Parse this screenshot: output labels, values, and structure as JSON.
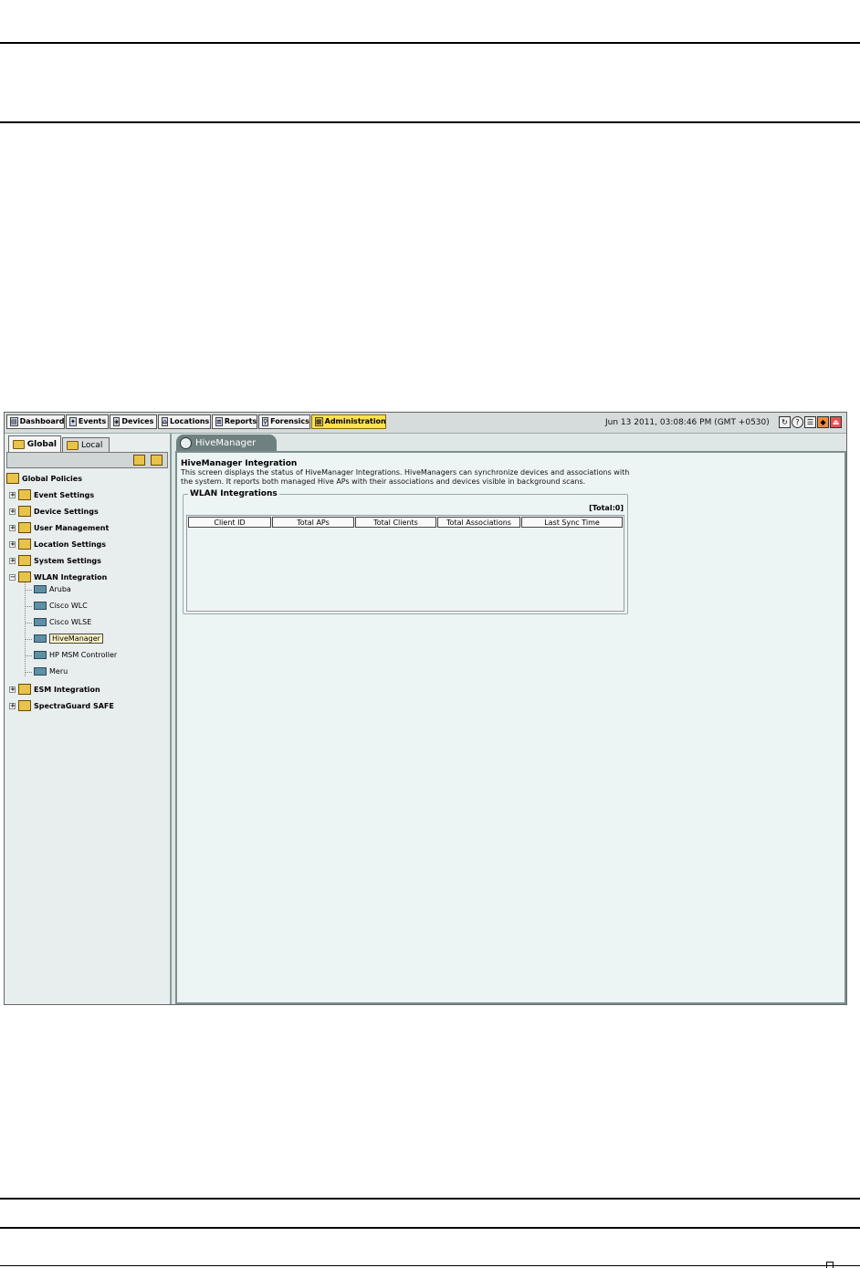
{
  "toolbar": {
    "tabs": [
      {
        "label": "Dashboard",
        "icon": "dashboard-icon"
      },
      {
        "label": "Events",
        "icon": "events-icon"
      },
      {
        "label": "Devices",
        "icon": "devices-icon"
      },
      {
        "label": "Locations",
        "icon": "locations-icon"
      },
      {
        "label": "Reports",
        "icon": "reports-icon"
      },
      {
        "label": "Forensics",
        "icon": "forensics-icon"
      },
      {
        "label": "Administration",
        "icon": "administration-icon",
        "active": true
      }
    ],
    "datetime": "Jun 13 2011, 03:08:46 PM (GMT +0530)",
    "icons": [
      "refresh-icon",
      "help-icon",
      "list-icon",
      "shield-icon",
      "logout-icon"
    ]
  },
  "left_panel": {
    "tabs": [
      {
        "label": "Global",
        "active": true
      },
      {
        "label": "Local",
        "active": false
      }
    ],
    "tree": {
      "root": "Global Policies",
      "items": [
        {
          "label": "Event Settings"
        },
        {
          "label": "Device Settings"
        },
        {
          "label": "User Management"
        },
        {
          "label": "Location Settings"
        },
        {
          "label": "System Settings"
        },
        {
          "label": "WLAN Integration",
          "expanded": true,
          "children": [
            "Aruba",
            "Cisco WLC",
            "Cisco WLSE",
            "HiveManager",
            "HP MSM Controller",
            "Meru"
          ]
        },
        {
          "label": "ESM Integration"
        },
        {
          "label": "SpectraGuard SAFE"
        }
      ],
      "selected": "HiveManager"
    }
  },
  "main": {
    "tab_label": "HiveManager",
    "title": "HiveManager Integration",
    "description": "This screen displays the status of HiveManager Integrations. HiveManagers can synchronize devices and associations with the system. It reports both managed Hive APs with their associations and devices visible in background scans.",
    "section_title": "WLAN Integrations",
    "total": "[Total:0]",
    "columns": [
      "Client ID",
      "Total APs",
      "Total Clients",
      "Total Associations",
      "Last Sync Time"
    ]
  },
  "colors": {
    "active_tab": "#ffe24a",
    "content_bg": "#edf4f4",
    "tab_header": "#6e8080"
  }
}
